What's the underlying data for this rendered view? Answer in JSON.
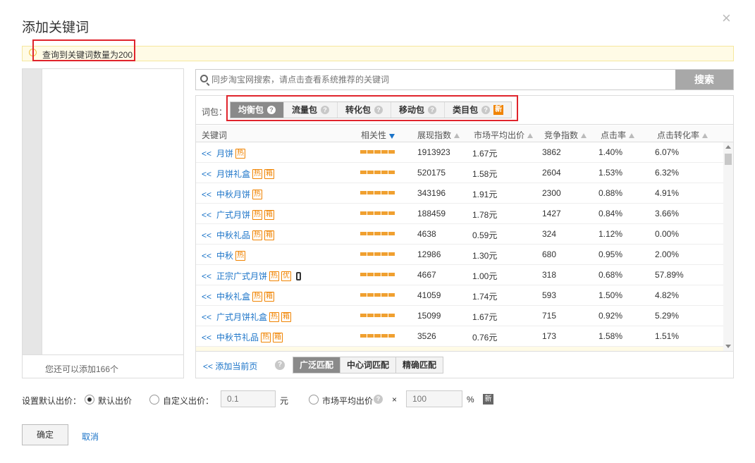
{
  "dialog": {
    "title": "添加关键词",
    "close_symbol": "×",
    "notice": "查询到关键词数量为200"
  },
  "left_panel": {
    "footer_text": "您还可以添加166个"
  },
  "search": {
    "placeholder": "同步淘宝网搜索，请点击查看系统推荐的关键词",
    "button_label": "搜索"
  },
  "packages": {
    "label": "词包：",
    "tabs": [
      {
        "label": "均衡包",
        "active": true
      },
      {
        "label": "流量包",
        "active": false
      },
      {
        "label": "转化包",
        "active": false
      },
      {
        "label": "移动包",
        "active": false
      },
      {
        "label": "类目包",
        "active": false,
        "badge": "新"
      }
    ],
    "help_symbol": "?"
  },
  "table": {
    "headers": {
      "keyword": "关键词",
      "relevance": "相关性",
      "impressions": "展现指数",
      "avg_bid": "市场平均出价",
      "competition": "竞争指数",
      "ctr": "点击率",
      "cvr": "点击转化率"
    },
    "row_prefix": "<<",
    "rows": [
      {
        "keyword": "月饼",
        "tags": [
          "热"
        ],
        "mobile": false,
        "relevance": 5,
        "impressions": "1913923",
        "avg_bid": "1.67元",
        "competition": "3862",
        "ctr": "1.40%",
        "cvr": "6.07%"
      },
      {
        "keyword": "月饼礼盒",
        "tags": [
          "热",
          "箱"
        ],
        "mobile": false,
        "relevance": 5,
        "impressions": "520175",
        "avg_bid": "1.58元",
        "competition": "2604",
        "ctr": "1.53%",
        "cvr": "6.32%"
      },
      {
        "keyword": "中秋月饼",
        "tags": [
          "热"
        ],
        "mobile": false,
        "relevance": 5,
        "impressions": "343196",
        "avg_bid": "1.91元",
        "competition": "2300",
        "ctr": "0.88%",
        "cvr": "4.91%"
      },
      {
        "keyword": "广式月饼",
        "tags": [
          "热",
          "箱"
        ],
        "mobile": false,
        "relevance": 5,
        "impressions": "188459",
        "avg_bid": "1.78元",
        "competition": "1427",
        "ctr": "0.84%",
        "cvr": "3.66%"
      },
      {
        "keyword": "中秋礼品",
        "tags": [
          "热",
          "箱"
        ],
        "mobile": false,
        "relevance": 5,
        "impressions": "4638",
        "avg_bid": "0.59元",
        "competition": "324",
        "ctr": "1.12%",
        "cvr": "0.00%"
      },
      {
        "keyword": "中秋",
        "tags": [
          "热"
        ],
        "mobile": false,
        "relevance": 5,
        "impressions": "12986",
        "avg_bid": "1.30元",
        "competition": "680",
        "ctr": "0.95%",
        "cvr": "2.00%"
      },
      {
        "keyword": "正宗广式月饼",
        "tags": [
          "热",
          "优"
        ],
        "mobile": true,
        "relevance": 5,
        "impressions": "4667",
        "avg_bid": "1.00元",
        "competition": "318",
        "ctr": "0.68%",
        "cvr": "57.89%"
      },
      {
        "keyword": "中秋礼盒",
        "tags": [
          "热",
          "箱"
        ],
        "mobile": false,
        "relevance": 5,
        "impressions": "41059",
        "avg_bid": "1.74元",
        "competition": "593",
        "ctr": "1.50%",
        "cvr": "4.82%"
      },
      {
        "keyword": "广式月饼礼盒",
        "tags": [
          "热",
          "箱"
        ],
        "mobile": false,
        "relevance": 5,
        "impressions": "15099",
        "avg_bid": "1.67元",
        "competition": "715",
        "ctr": "0.92%",
        "cvr": "5.29%"
      },
      {
        "keyword": "中秋节礼品",
        "tags": [
          "热",
          "箱"
        ],
        "mobile": false,
        "relevance": 5,
        "impressions": "3526",
        "avg_bid": "0.76元",
        "competition": "173",
        "ctr": "1.58%",
        "cvr": "1.51%"
      }
    ]
  },
  "panel_footer": {
    "add_page": "<<  添加当前页",
    "match_tabs": [
      {
        "label": "广泛匹配",
        "active": true
      },
      {
        "label": "中心词匹配",
        "active": false
      },
      {
        "label": "精确匹配",
        "active": false
      }
    ]
  },
  "bid": {
    "label": "设置默认出价：",
    "options": {
      "default_label": "默认出价",
      "custom_label": "自定义出价：",
      "custom_value_placeholder": "0.1",
      "custom_unit": "元",
      "market_label": "市场平均出价",
      "times_symbol": "×",
      "percent_placeholder": "100",
      "percent_unit": "%",
      "new_badge": "新"
    },
    "selected": "default"
  },
  "actions": {
    "ok_label": "确定",
    "cancel_label": "取消"
  },
  "colors": {
    "link": "#1a73c8",
    "highlight_box": "#e0242c",
    "tag_orange": "#f08300",
    "active_tab": "#8a8a8a"
  }
}
